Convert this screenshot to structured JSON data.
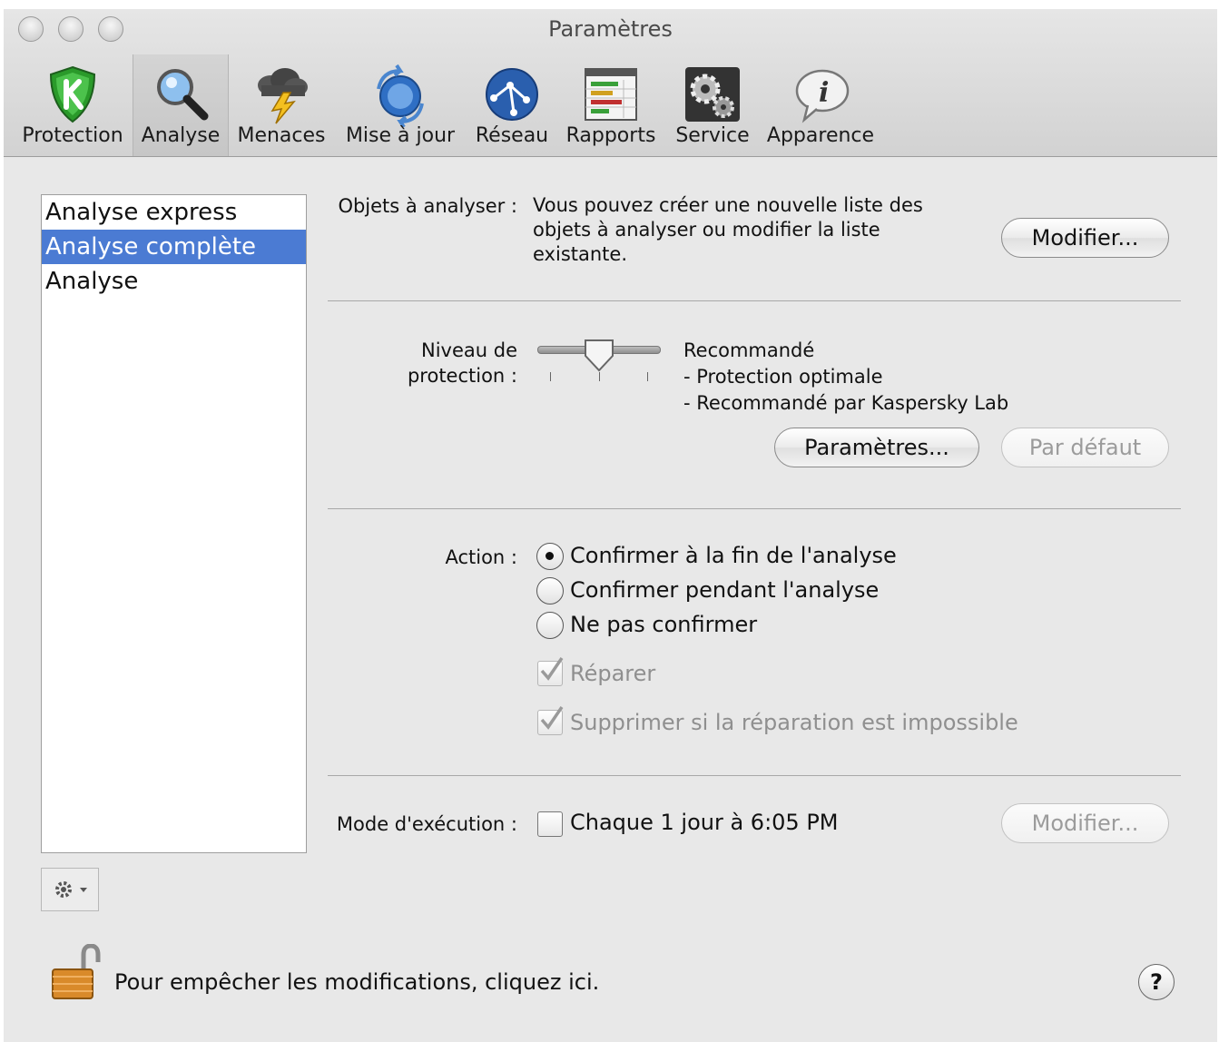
{
  "window": {
    "title": "Paramètres"
  },
  "toolbar": {
    "items": [
      {
        "label": "Protection",
        "icon": "shield-k-icon"
      },
      {
        "label": "Analyse",
        "icon": "magnifier-icon",
        "selected": true
      },
      {
        "label": "Menaces",
        "icon": "storm-cloud-icon"
      },
      {
        "label": "Mise à jour",
        "icon": "globe-update-icon"
      },
      {
        "label": "Réseau",
        "icon": "network-globe-icon"
      },
      {
        "label": "Rapports",
        "icon": "report-table-icon"
      },
      {
        "label": "Service",
        "icon": "gears-icon"
      },
      {
        "label": "Apparence",
        "icon": "info-bubble-icon"
      }
    ]
  },
  "sidebar": {
    "items": [
      {
        "label": "Analyse express"
      },
      {
        "label": "Analyse complète",
        "selected": true
      },
      {
        "label": "Analyse"
      }
    ],
    "gear_icon": "gear-icon"
  },
  "objects": {
    "label": "Objets à analyser :",
    "description": "Vous pouvez créer une nouvelle liste des objets à analyser ou modifier la liste existante.",
    "button": "Modifier..."
  },
  "protection": {
    "label_line1": "Niveau de",
    "label_line2": "protection :",
    "level": "Recommandé",
    "slider_position": 0.5,
    "details": [
      "- Protection optimale",
      "- Recommandé par Kaspersky Lab"
    ],
    "settings_button": "Paramètres...",
    "default_button": "Par défaut"
  },
  "action": {
    "label": "Action :",
    "options": [
      {
        "label": "Confirmer à la fin de l'analyse",
        "checked": true
      },
      {
        "label": "Confirmer pendant l'analyse",
        "checked": false
      },
      {
        "label": "Ne pas confirmer",
        "checked": false
      }
    ],
    "repair": {
      "label": "Réparer",
      "checked": true,
      "enabled": false
    },
    "delete": {
      "label": "Supprimer si la réparation est impossible",
      "checked": true,
      "enabled": false
    }
  },
  "schedule": {
    "label": "Mode d'exécution :",
    "checkbox_label": "Chaque 1 jour à 6:05 PM",
    "checked": false,
    "button": "Modifier..."
  },
  "footer": {
    "lock_text": "Pour empêcher les modifications, cliquez ici.",
    "help": "?"
  },
  "colors": {
    "selection": "#4b7bd3",
    "window": "#e8e8e8"
  }
}
